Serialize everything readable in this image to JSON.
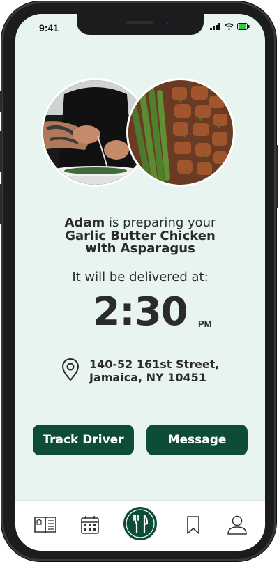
{
  "status_bar": {
    "time": "9:41"
  },
  "order": {
    "chef_name": "Adam",
    "preparing_text": "is preparing your",
    "dish_line1": "Garlic Butter Chicken",
    "dish_line2": "with Asparagus"
  },
  "delivery": {
    "label": "It will be delivered at:",
    "time": "2:30",
    "period": "PM"
  },
  "address": {
    "line1": "140-52 161st Street,",
    "line2": "Jamaica, NY 10451"
  },
  "actions": {
    "track_label": "Track Driver",
    "message_label": "Message"
  },
  "tabs": [
    {
      "icon": "menu-book-icon"
    },
    {
      "icon": "calendar-icon"
    },
    {
      "icon": "fork-knife-icon",
      "active": true
    },
    {
      "icon": "bookmark-icon"
    },
    {
      "icon": "profile-icon"
    }
  ],
  "colors": {
    "accent": "#0e4d35",
    "screen_bg": "#e8f4f0"
  }
}
